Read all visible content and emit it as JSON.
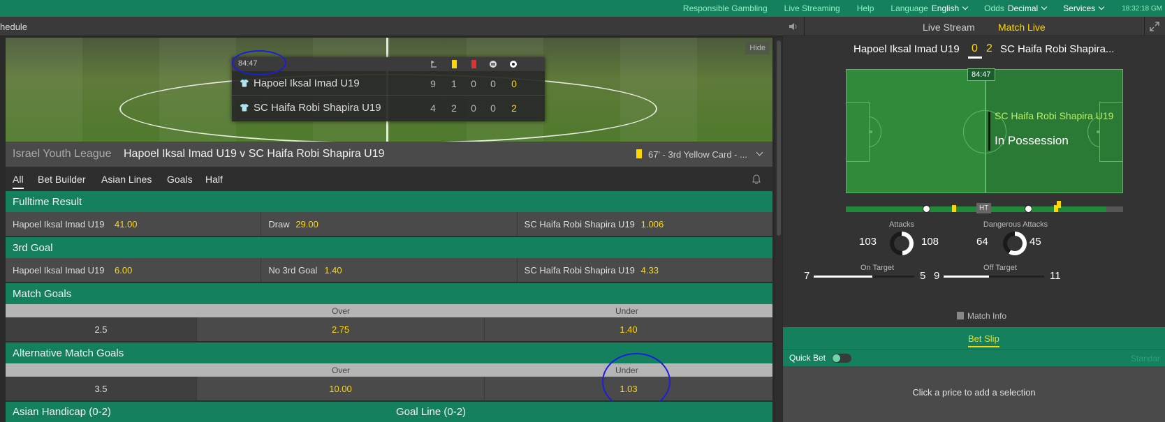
{
  "topbar": {
    "links": [
      "Responsible Gambling",
      "Live Streaming",
      "Help"
    ],
    "language_label": "Language",
    "language_value": "English",
    "odds_label": "Odds",
    "odds_value": "Decimal",
    "services": "Services",
    "clock": "18:32:18 GM"
  },
  "subbar": {
    "title": "hedule"
  },
  "scoreboard": {
    "time": "84:47",
    "hide": "Hide",
    "home": {
      "name": "Hapoel Iksal Imad U19",
      "corners": "9",
      "yellow": "1",
      "red": "0",
      "subs": "0",
      "goals": "0"
    },
    "away": {
      "name": "SC Haifa Robi Shapira U19",
      "corners": "4",
      "yellow": "2",
      "red": "0",
      "subs": "0",
      "goals": "2"
    }
  },
  "matchbar": {
    "league": "Israel Youth League",
    "title": "Hapoel Iksal Imad U19 v SC Haifa Robi Shapira U19",
    "event": "67' - 3rd Yellow Card - ..."
  },
  "tabs": [
    "All",
    "Bet Builder",
    "Asian Lines",
    "Goals",
    "Half"
  ],
  "markets": {
    "fulltime": {
      "title": "Fulltime Result",
      "home_name": "Hapoel Iksal Imad U19",
      "home_price": "41.00",
      "draw_name": "Draw",
      "draw_price": "29.00",
      "away_name": "SC Haifa Robi Shapira U19",
      "away_price": "1.006"
    },
    "third_goal": {
      "title": "3rd Goal",
      "home_name": "Hapoel Iksal Imad U19",
      "home_price": "6.00",
      "none_name": "No 3rd Goal",
      "none_price": "1.40",
      "away_name": "SC Haifa Robi Shapira U19",
      "away_price": "4.33"
    },
    "match_goals": {
      "title": "Match Goals",
      "over_label": "Over",
      "under_label": "Under",
      "line": "2.5",
      "over": "2.75",
      "under": "1.40"
    },
    "alt_match_goals": {
      "title": "Alternative Match Goals",
      "over_label": "Over",
      "under_label": "Under",
      "line": "3.5",
      "over": "10.00",
      "under": "1.03"
    },
    "asian_handicap": "Asian Handicap (0-2)",
    "goal_line": "Goal Line (0-2)"
  },
  "right": {
    "tabs": {
      "stream": "Live Stream",
      "live": "Match Live"
    },
    "home": "Hapoel Iksal Imad U19",
    "away": "SC Haifa Robi Shapira...",
    "home_score": "0",
    "away_score": "2",
    "clock": "84:47",
    "possession_team": "SC Haifa Robi Shapira U19",
    "possession_state": "In Possession",
    "ht": "HT",
    "elapsed_fraction": 0.94,
    "attacks": {
      "label": "Attacks",
      "home": "103",
      "away": "108"
    },
    "dangerous": {
      "label": "Dangerous Attacks",
      "home": "64",
      "away": "45"
    },
    "on_target": {
      "label": "On Target",
      "home": "7",
      "away": "5"
    },
    "off_target": {
      "label": "Off Target",
      "home": "9",
      "away": "11"
    },
    "match_info": "Match Info"
  },
  "betslip": {
    "title": "Bet Slip",
    "quick_bet": "Quick Bet",
    "standard": "Standar",
    "empty": "Click a price to add a selection"
  },
  "colors": {
    "brand": "#14805e",
    "price": "#ffd700",
    "annotation": "#1d1ddb"
  }
}
